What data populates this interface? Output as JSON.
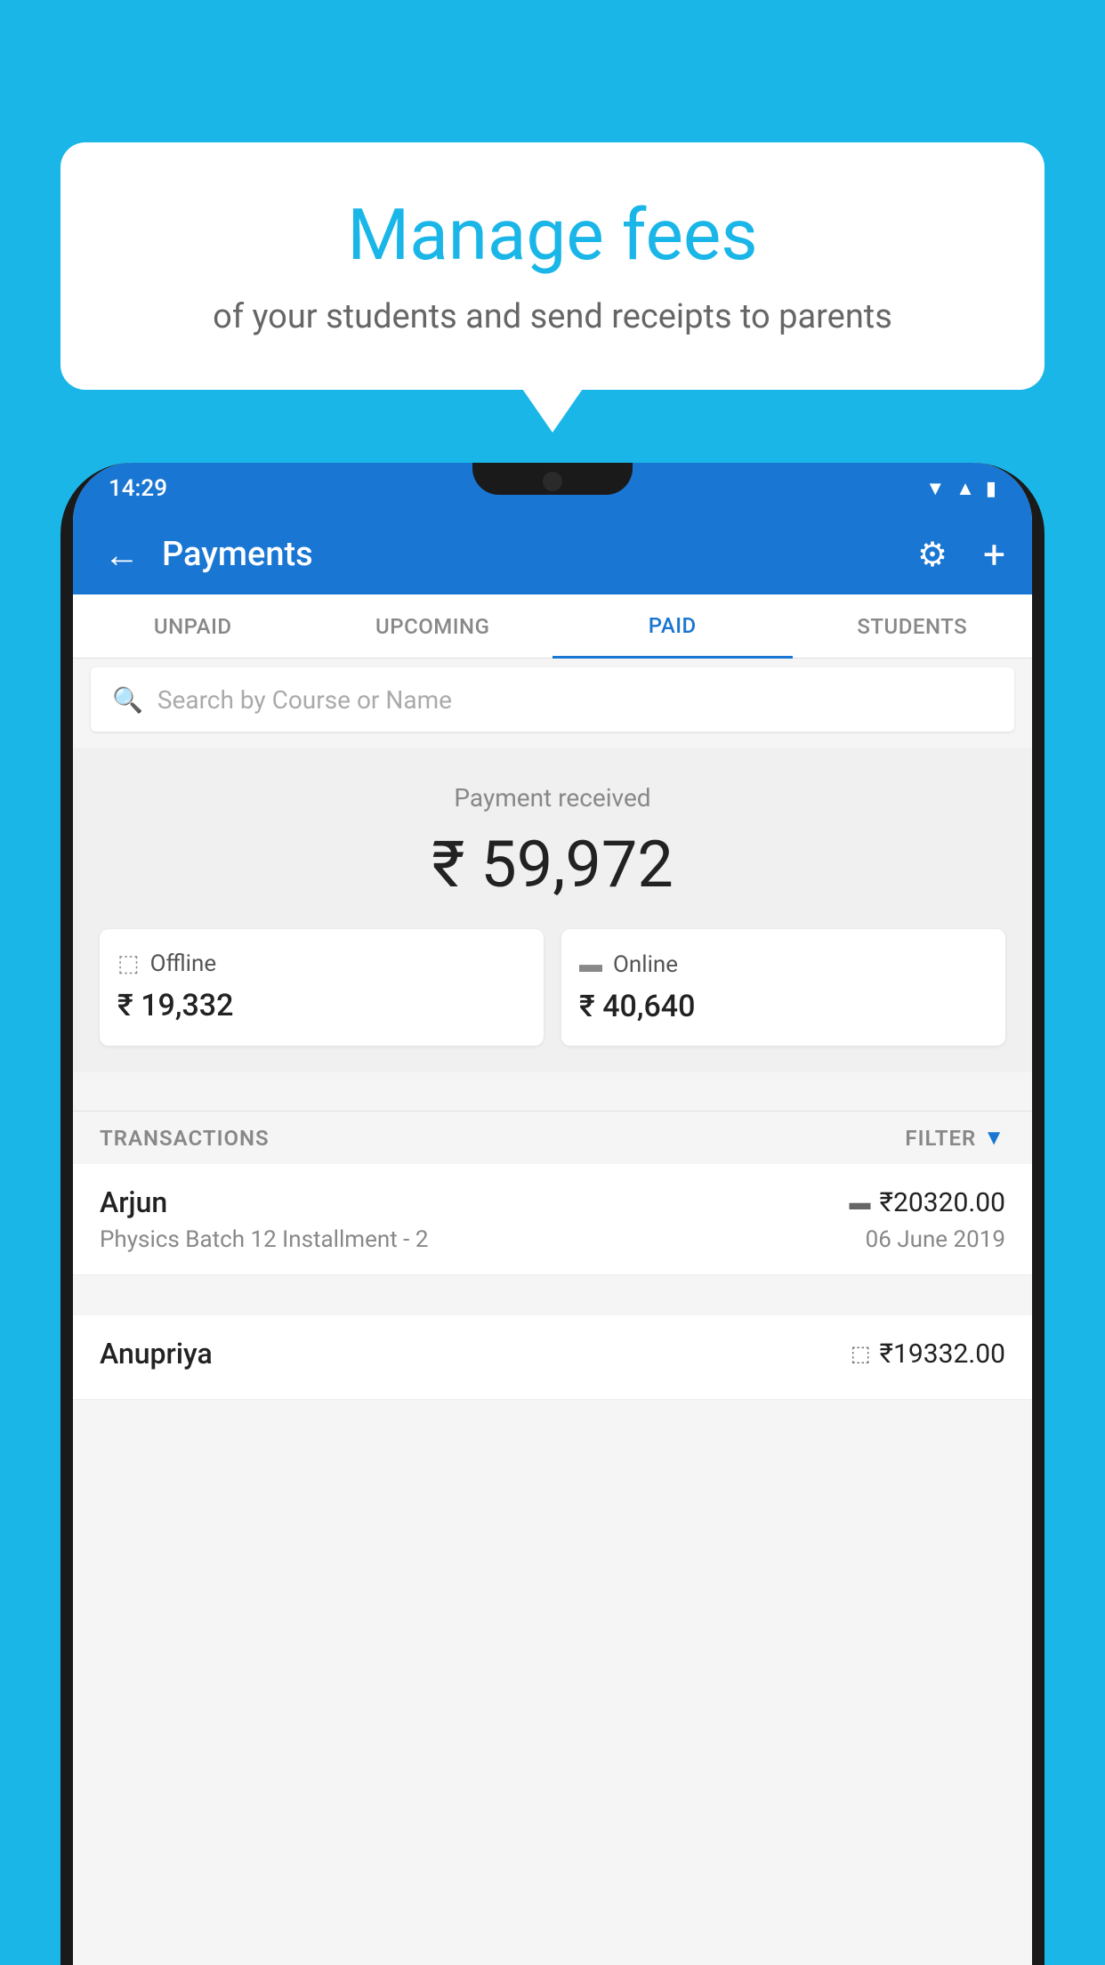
{
  "background": {
    "color": "#1ab6e8"
  },
  "bubble": {
    "title": "Manage fees",
    "subtitle": "of your students and send receipts to parents"
  },
  "phone": {
    "status_bar": {
      "time": "14:29"
    },
    "app_bar": {
      "title": "Payments",
      "back_label": "←",
      "gear_label": "⚙",
      "plus_label": "+"
    },
    "tabs": [
      {
        "label": "UNPAID",
        "active": false
      },
      {
        "label": "UPCOMING",
        "active": false
      },
      {
        "label": "PAID",
        "active": true
      },
      {
        "label": "STUDENTS",
        "active": false
      }
    ],
    "search": {
      "placeholder": "Search by Course or Name"
    },
    "payment_received": {
      "label": "Payment received",
      "amount": "₹ 59,972",
      "offline": {
        "label": "Offline",
        "amount": "₹ 19,332"
      },
      "online": {
        "label": "Online",
        "amount": "₹ 40,640"
      }
    },
    "transactions": {
      "label": "TRANSACTIONS",
      "filter_label": "FILTER",
      "items": [
        {
          "name": "Arjun",
          "amount": "₹20320.00",
          "payment_type": "online",
          "course": "Physics Batch 12 Installment - 2",
          "date": "06 June 2019"
        },
        {
          "name": "Anupriya",
          "amount": "₹19332.00",
          "payment_type": "offline",
          "course": "",
          "date": ""
        }
      ]
    }
  }
}
